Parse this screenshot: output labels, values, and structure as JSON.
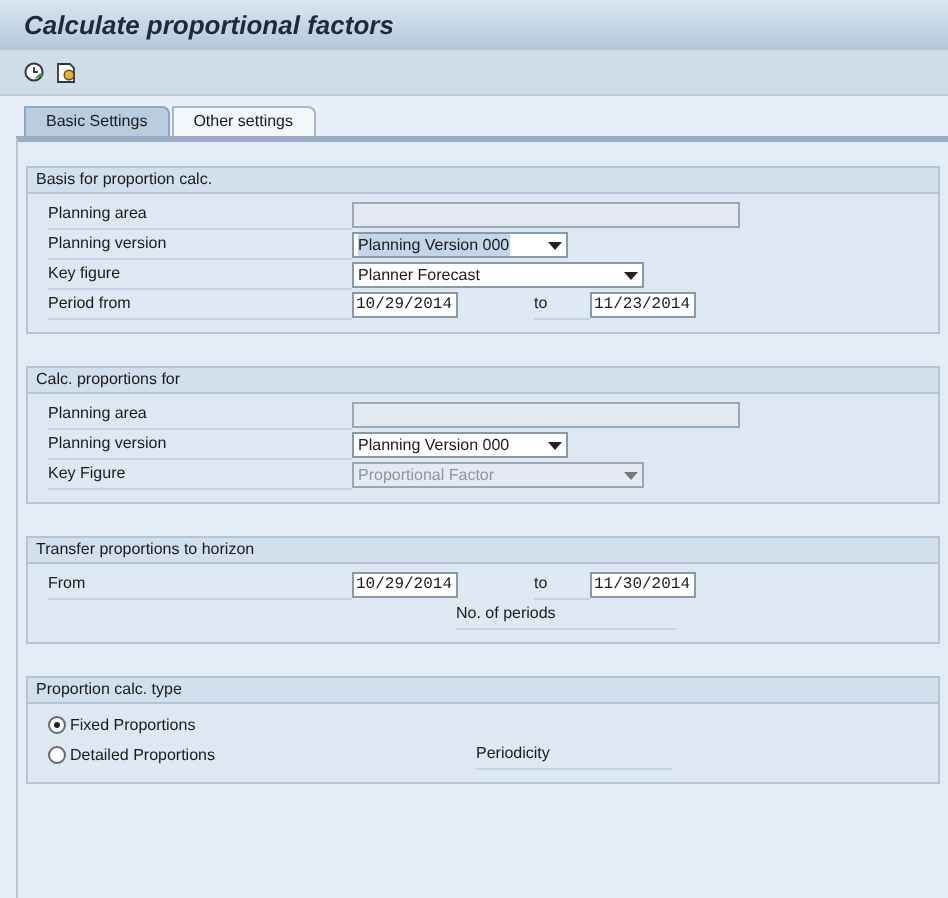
{
  "window": {
    "title": "Calculate proportional factors"
  },
  "tabs": [
    {
      "label": "Basic Settings",
      "selected": true
    },
    {
      "label": "Other settings",
      "selected": false
    }
  ],
  "sections": [
    {
      "title": "Basis for proportion calc.",
      "rows": [
        {
          "kind": "field",
          "label": "Planning area",
          "disabled": true
        },
        {
          "kind": "short_dropdown",
          "label": "Planning version",
          "value": "Planning Version 000",
          "disabled": false,
          "highlighted": true
        },
        {
          "kind": "long_dropdown",
          "label": "Key figure",
          "value": "Planner Forecast",
          "disabled": false,
          "highlighted": false
        },
        {
          "kind": "range",
          "label": "Period from",
          "from": "10/29/2014",
          "to_label": "to",
          "to": "11/23/2014"
        }
      ]
    },
    {
      "title": "Calc. proportions for",
      "rows": [
        {
          "kind": "field",
          "label": "Planning area",
          "disabled": true
        },
        {
          "kind": "short_dropdown",
          "label": "Planning version",
          "value": "Planning Version 000",
          "disabled": false,
          "highlighted": false
        },
        {
          "kind": "long_dropdown",
          "label": "Key Figure",
          "value": "Proportional Factor",
          "disabled": true,
          "highlighted": false
        }
      ]
    },
    {
      "title": "Transfer proportions to horizon",
      "rows": [
        {
          "kind": "range",
          "label": "From",
          "from": "10/29/2014",
          "to_label": "to",
          "to": "11/30/2014"
        },
        {
          "kind": "caption",
          "label": "No. of periods"
        }
      ]
    },
    {
      "title": "Proportion calc. type",
      "rows": [
        {
          "kind": "radio",
          "label": "Fixed Proportions",
          "selected": true
        },
        {
          "kind": "radio",
          "label": "Detailed Proportions",
          "selected": false,
          "side_label": "Periodicity"
        }
      ]
    }
  ]
}
